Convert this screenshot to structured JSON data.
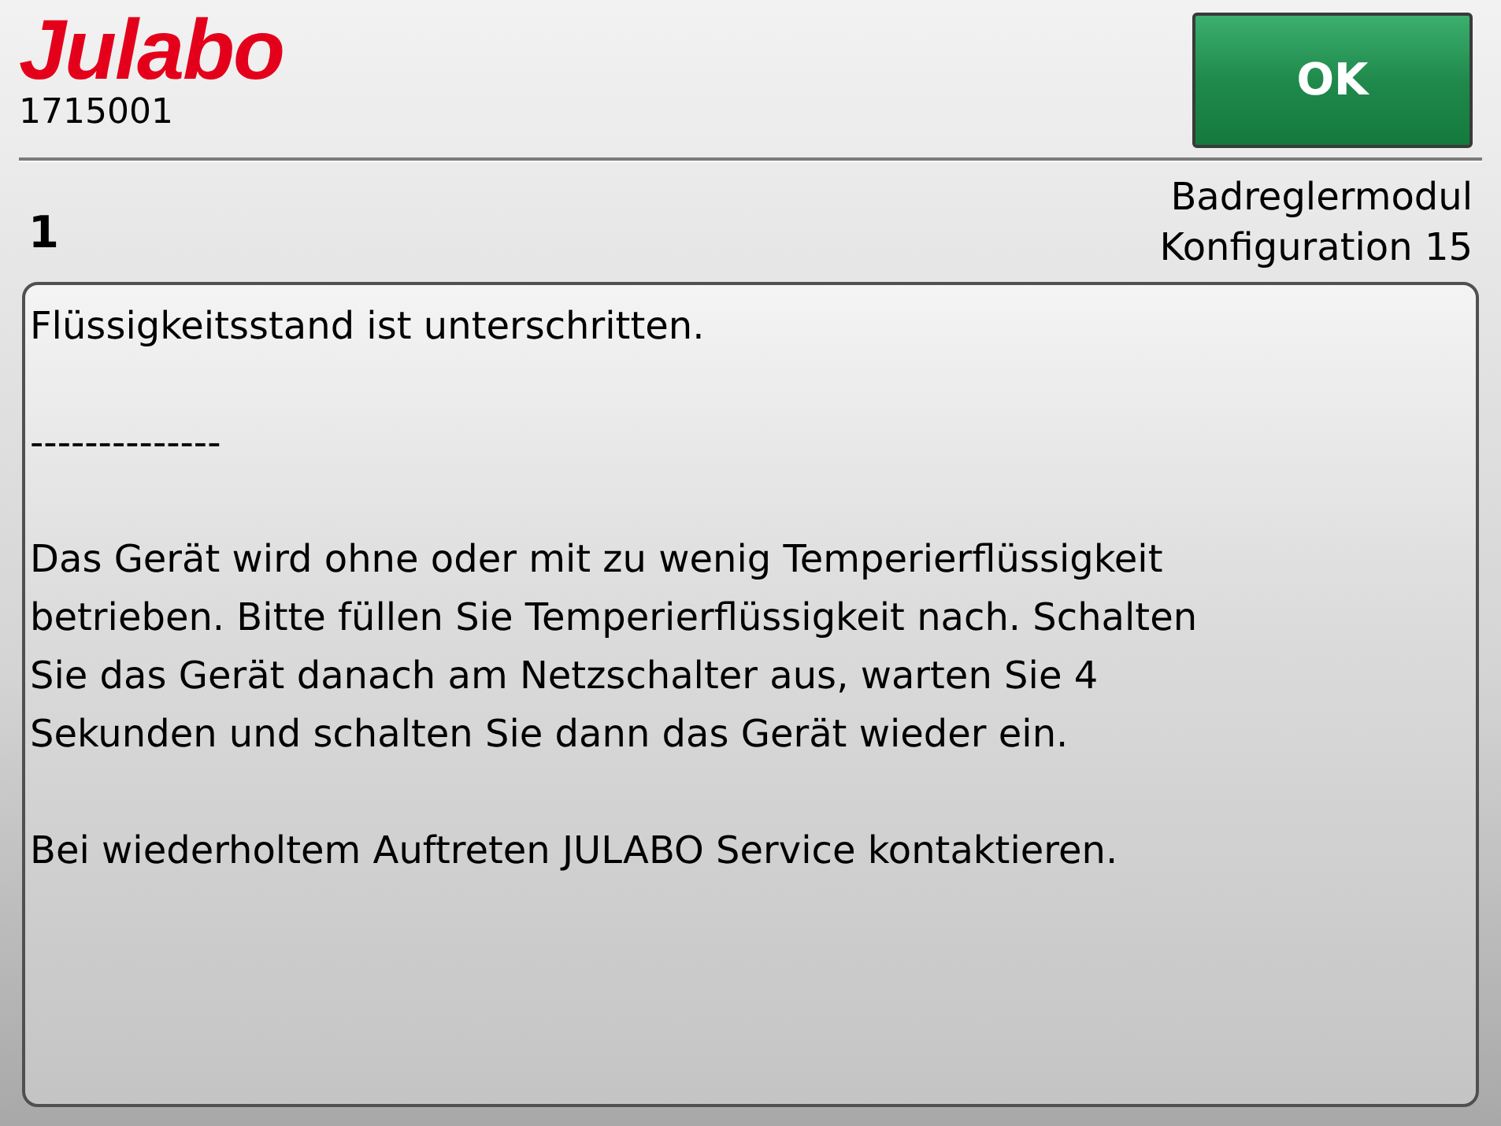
{
  "header": {
    "logo": "Julabo",
    "serial": "1715001",
    "ok_button": "OK"
  },
  "info": {
    "number": "1",
    "module": "Badreglermodul",
    "configuration": "Konfiguration 15"
  },
  "message": {
    "paragraphs": [
      [
        "Flüssigkeitsstand ist unterschritten."
      ],
      [
        "--------------"
      ],
      [
        "Das Gerät wird ohne oder mit zu wenig Temperierflüssigkeit",
        "betrieben. Bitte füllen Sie Temperierflüssigkeit nach. Schalten",
        "Sie das Gerät danach am Netzschalter aus, warten Sie 4",
        "Sekunden und schalten Sie dann das Gerät wieder ein."
      ],
      [
        "Bei wiederholtem Auftreten JULABO Service kontaktieren."
      ]
    ]
  }
}
